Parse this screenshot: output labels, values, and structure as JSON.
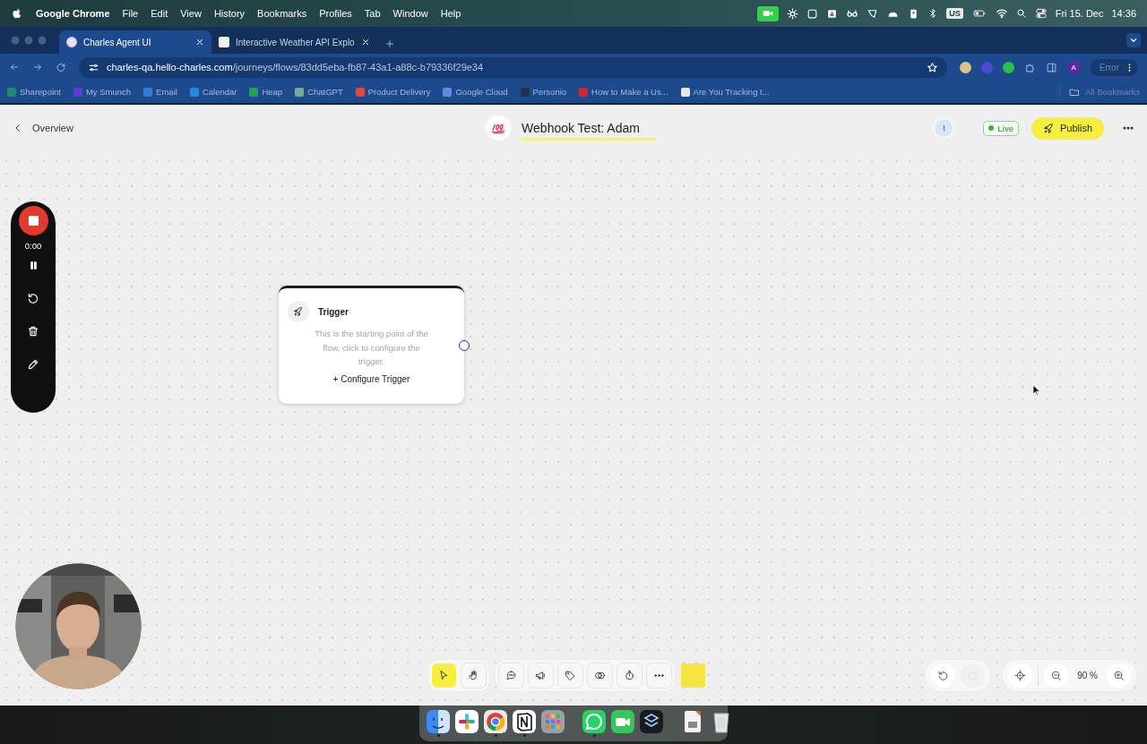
{
  "menubar": {
    "app": "Google Chrome",
    "menus": [
      "File",
      "Edit",
      "View",
      "History",
      "Bookmarks",
      "Profiles",
      "Tab",
      "Window",
      "Help"
    ],
    "keyboard": "US",
    "date": "Fri 15. Dec",
    "time": "14:36"
  },
  "tabs": [
    {
      "title": "Charles Agent UI",
      "selected": true
    },
    {
      "title": "Interactive Weather API Explo",
      "selected": false
    }
  ],
  "address": {
    "host": "charles-qa.hello-charles.com",
    "path": "/journeys/flows/83dd5eba-fb87-43a1-a88c-b79336f29e34",
    "profile": "A",
    "status": "Error"
  },
  "bookmarks": [
    {
      "label": "Sharepoint",
      "color": "#1f8a70"
    },
    {
      "label": "My Smunch",
      "color": "#5b3fd1"
    },
    {
      "label": "Email",
      "color": "#2f7bd8"
    },
    {
      "label": "Calendar",
      "color": "#2a86e0"
    },
    {
      "label": "Heap",
      "color": "#25a05a"
    },
    {
      "label": "ChatGPT",
      "color": "#74aa9c"
    },
    {
      "label": "Product Delivery",
      "color": "#e2473b"
    },
    {
      "label": "Google Cloud",
      "color": "#5a8fe0"
    },
    {
      "label": "Personio",
      "color": "#23304a"
    },
    {
      "label": "How to Make a Us...",
      "color": "#d0263a"
    },
    {
      "label": "Are You Tracking t...",
      "color": "#e8e8e8"
    }
  ],
  "all_bookmarks": "All Bookmarks",
  "header": {
    "back": "Overview",
    "title": "Webhook Test: Adam",
    "avatar": "t",
    "status": "Live",
    "publish": "Publish"
  },
  "recorder": {
    "time": "0:00"
  },
  "node": {
    "title": "Trigger",
    "description": "This is the starting point of the flow, click to configure the trigger.",
    "action": "+ Configure Trigger"
  },
  "toolbar": {
    "tools": [
      {
        "kind": "pointer",
        "selected": true
      },
      {
        "kind": "hand",
        "selected": false
      },
      {
        "kind": "comment",
        "selected": false
      },
      {
        "kind": "megaphone",
        "selected": false
      },
      {
        "kind": "tag",
        "selected": false
      },
      {
        "kind": "overlap",
        "selected": false
      },
      {
        "kind": "timer",
        "selected": false
      },
      {
        "kind": "more",
        "selected": false
      },
      {
        "kind": "note",
        "selected": false
      }
    ],
    "history": [
      {
        "kind": "undo",
        "disabled": false
      },
      {
        "kind": "redo",
        "disabled": true
      }
    ],
    "zoom": "90 %"
  },
  "dock": [
    {
      "kind": "finder",
      "running": true
    },
    {
      "kind": "pinwheel",
      "running": false
    },
    {
      "kind": "browser",
      "running": true
    },
    {
      "kind": "notes",
      "running": true
    },
    {
      "kind": "grid",
      "running": false
    },
    {
      "kind": "chat",
      "running": true
    },
    {
      "kind": "video",
      "running": false
    },
    {
      "kind": "layers",
      "running": false
    },
    {
      "kind": "file",
      "running": false
    },
    {
      "kind": "trash",
      "running": false
    }
  ]
}
